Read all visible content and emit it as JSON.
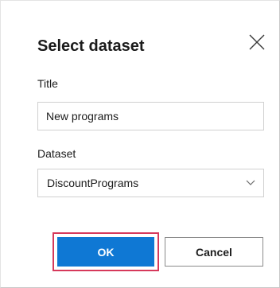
{
  "dialog": {
    "title": "Select dataset",
    "close_icon": "close-icon"
  },
  "fields": {
    "title_label": "Title",
    "title_value": "New programs",
    "dataset_label": "Dataset",
    "dataset_value": "DiscountPrograms",
    "dataset_icon": "chevron-down-icon"
  },
  "buttons": {
    "ok_label": "OK",
    "cancel_label": "Cancel"
  },
  "colors": {
    "primary": "#0f78d4",
    "highlight": "#d6395b",
    "border": "#d0d0d0"
  }
}
